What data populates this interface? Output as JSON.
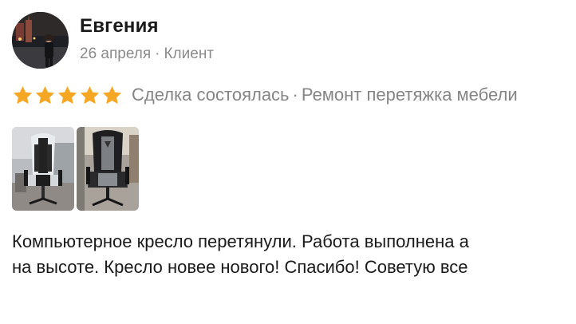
{
  "review": {
    "author": {
      "name": "Евгения",
      "date": "26 апреля",
      "separator": "·",
      "role": "Клиент"
    },
    "rating": {
      "stars": 5,
      "max_stars": 5,
      "star_color": "#f5a623",
      "deal_status": "Сделка состоялась",
      "separator": "·",
      "service": "Ремонт перетяжка мебели"
    },
    "photos": [
      {
        "icon": "chair-photo-1"
      },
      {
        "icon": "chair-photo-2"
      }
    ],
    "text": {
      "line1": "Компьютерное кресло перетянули. Работа выполнена а",
      "line2": "на высоте. Кресло новее нового! Спасибо! Советую все"
    }
  }
}
